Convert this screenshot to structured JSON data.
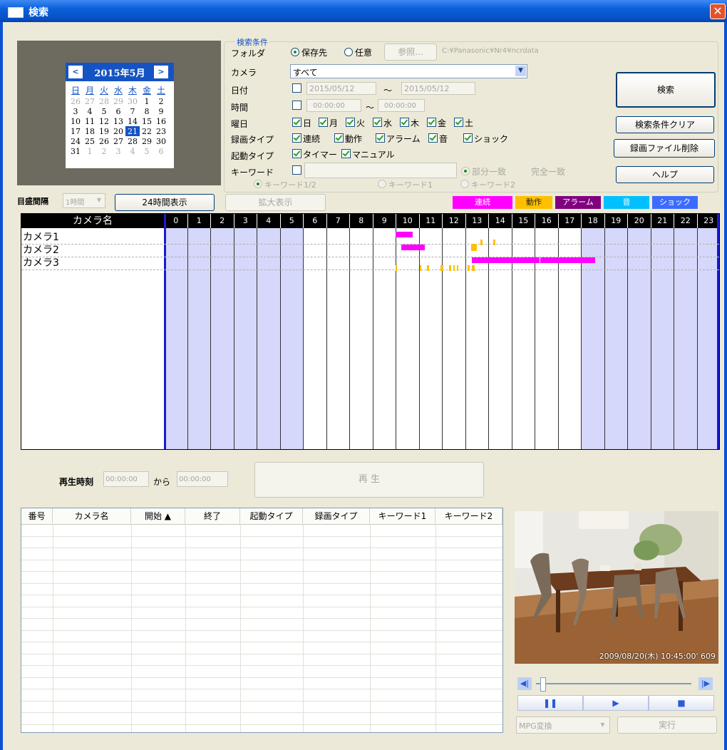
{
  "window": {
    "title": "検索",
    "close": "✕"
  },
  "calendar": {
    "month": "2015年5月",
    "prev": "<",
    "next": ">",
    "weekdays": [
      "日",
      "月",
      "火",
      "水",
      "木",
      "金",
      "土"
    ],
    "weeks": [
      [
        "26",
        "27",
        "28",
        "29",
        "30",
        "1",
        "2"
      ],
      [
        "3",
        "4",
        "5",
        "6",
        "7",
        "8",
        "9"
      ],
      [
        "10",
        "11",
        "12",
        "13",
        "14",
        "15",
        "16"
      ],
      [
        "17",
        "18",
        "19",
        "20",
        "21",
        "22",
        "23"
      ],
      [
        "24",
        "25",
        "26",
        "27",
        "28",
        "29",
        "30"
      ],
      [
        "31",
        "1",
        "2",
        "3",
        "4",
        "5",
        "6"
      ]
    ],
    "selected": "21"
  },
  "search": {
    "legend": "検索条件",
    "folder_label": "フォルダ",
    "folder_save": "保存先",
    "folder_any": "任意",
    "browse": "参照...",
    "folder_path": "C:¥Panasonic¥Nr4¥ncrdata",
    "camera_label": "カメラ",
    "camera_value": "すべて",
    "date_label": "日付",
    "date_from": "2015/05/12",
    "date_to": "2015/05/12",
    "tilde": "～",
    "time_label": "時間",
    "time_from": "00:00:00",
    "time_to": "00:00:00",
    "weekday_label": "曜日",
    "weekdays": [
      "日",
      "月",
      "火",
      "水",
      "木",
      "金",
      "土"
    ],
    "rectype_label": "録画タイプ",
    "rectypes": [
      "連続",
      "動作",
      "アラーム",
      "音",
      "ショック"
    ],
    "starttype_label": "起動タイプ",
    "starttypes": [
      "タイマー",
      "マニュアル"
    ],
    "keyword_label": "キーワード",
    "match_partial": "部分一致",
    "match_exact": "完全一致",
    "kw12": "キーワード1/2",
    "kw1": "キーワード1",
    "kw2": "キーワード2"
  },
  "buttons": {
    "search": "検索",
    "clear": "検索条件クリア",
    "delete": "録画ファイル削除",
    "help": "ヘルプ",
    "display24": "24時間表示",
    "zoom": "拡大表示",
    "play": "再 生",
    "run": "実行"
  },
  "scale": {
    "label": "目盛間隔",
    "value": "1時間"
  },
  "legend": [
    {
      "label": "連続",
      "color": "#ff00ff"
    },
    {
      "label": "動作",
      "color": "#ffc000"
    },
    {
      "label": "アラーム",
      "color": "#800080"
    },
    {
      "label": "音",
      "color": "#00c0ff"
    },
    {
      "label": "ショック",
      "color": "#3c6cff"
    }
  ],
  "timeline": {
    "name_header": "カメラ名",
    "hours": [
      "0",
      "1",
      "2",
      "3",
      "4",
      "5",
      "6",
      "7",
      "8",
      "9",
      "10",
      "11",
      "12",
      "13",
      "14",
      "15",
      "16",
      "17",
      "18",
      "19",
      "20",
      "21",
      "22",
      "23"
    ],
    "cameras": [
      "カメラ1",
      "カメラ2",
      "カメラ3"
    ],
    "colors": {
      "continuous": "#ff00ff",
      "motion": "#ffc000",
      "shaded": "#d5d8fa"
    },
    "segments": [
      {
        "camera": 0,
        "type": "continuous",
        "start": 10.0,
        "end": 10.75
      },
      {
        "camera": 0,
        "type": "motion",
        "start": 13.65,
        "end": 13.75
      },
      {
        "camera": 0,
        "type": "motion",
        "start": 14.2,
        "end": 14.3
      },
      {
        "camera": 1,
        "type": "continuous",
        "start": 10.25,
        "end": 11.25
      },
      {
        "camera": 1,
        "type": "motion",
        "start": 13.25,
        "end": 13.5
      },
      {
        "camera": 2,
        "type": "continuous",
        "start": 13.3,
        "end": 16.2
      },
      {
        "camera": 2,
        "type": "continuous",
        "start": 16.25,
        "end": 18.6
      },
      {
        "camera": 2,
        "type": "motion",
        "start": 10.0,
        "end": 10.05
      },
      {
        "camera": 2,
        "type": "motion",
        "start": 11.05,
        "end": 11.12
      },
      {
        "camera": 2,
        "type": "motion",
        "start": 11.35,
        "end": 11.45
      },
      {
        "camera": 2,
        "type": "motion",
        "start": 11.95,
        "end": 12.05
      },
      {
        "camera": 2,
        "type": "motion",
        "start": 12.3,
        "end": 12.4
      },
      {
        "camera": 2,
        "type": "motion",
        "start": 12.5,
        "end": 12.55
      },
      {
        "camera": 2,
        "type": "motion",
        "start": 12.65,
        "end": 12.7
      },
      {
        "camera": 2,
        "type": "motion",
        "start": 13.1,
        "end": 13.2
      },
      {
        "camera": 2,
        "type": "motion",
        "start": 13.3,
        "end": 13.4
      }
    ]
  },
  "playback": {
    "label": "再生時刻",
    "from": "00:00:00",
    "kara": "から",
    "to": "00:00:00"
  },
  "list": {
    "columns": [
      "番号",
      "カメラ名",
      "開始 ▲",
      "終了",
      "起動タイプ",
      "録画タイプ",
      "キーワード1",
      "キーワード2"
    ]
  },
  "preview": {
    "timestamp": "2009/08/20(木) 10:45:00' 609"
  },
  "convert": {
    "format": "MPG変換"
  }
}
